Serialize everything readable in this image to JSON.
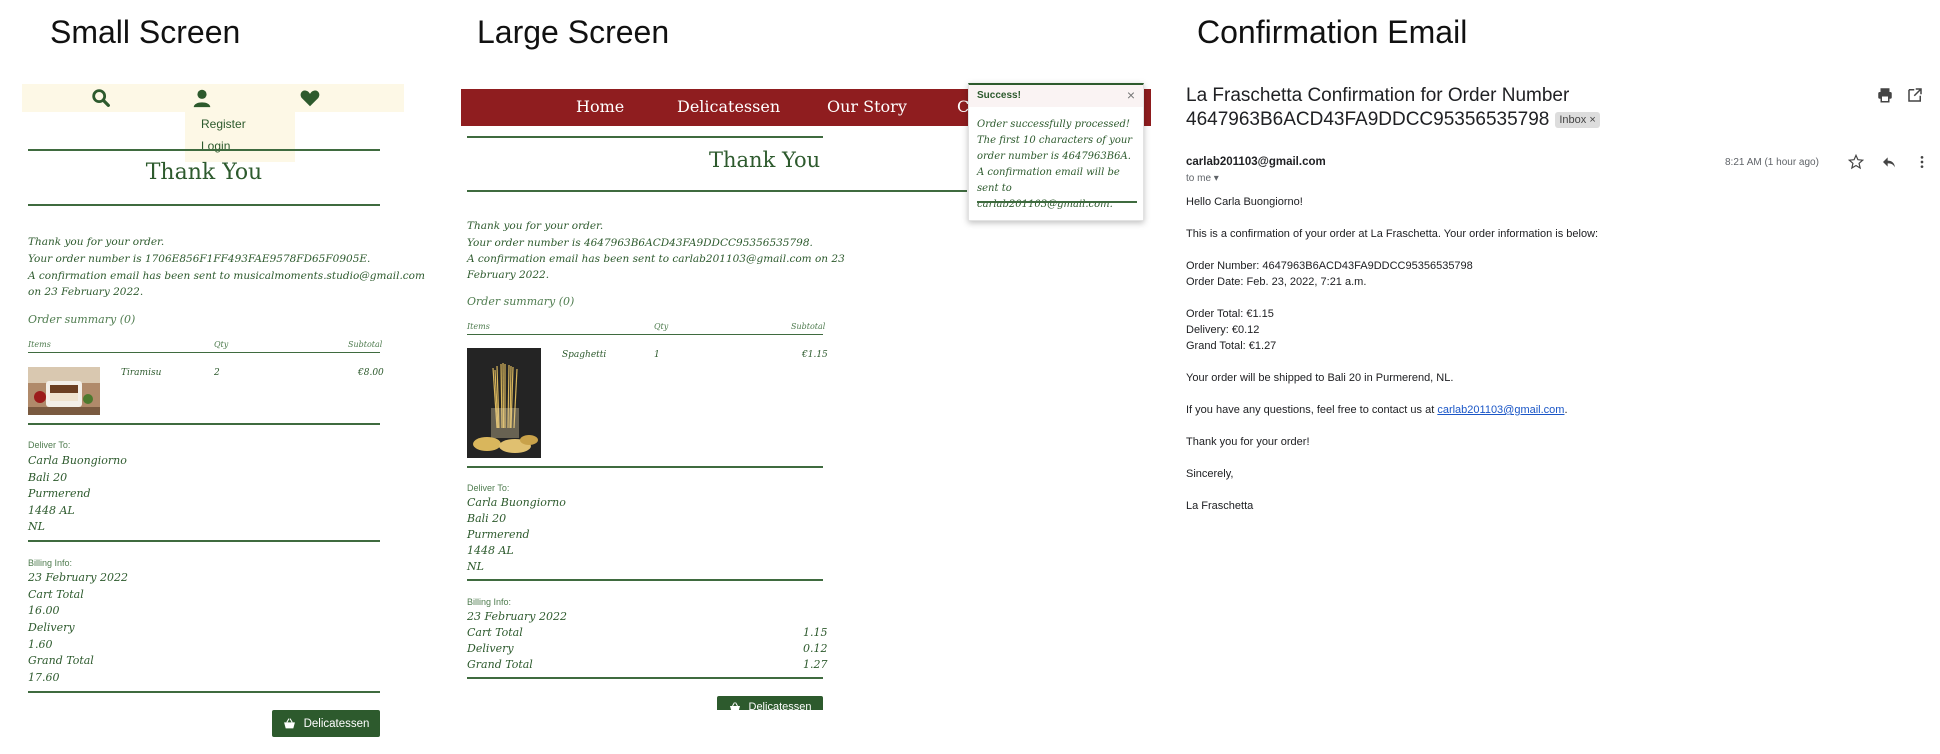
{
  "panels": {
    "small_title": "Small Screen",
    "large_title": "Large Screen",
    "email_title": "Confirmation Email"
  },
  "small": {
    "nav_icons": [
      "search-icon",
      "user-icon",
      "heart-icon"
    ],
    "dropdown": {
      "register": "Register",
      "login": "Login"
    },
    "heading": "Thank You",
    "thanks": "Thank you for your order.",
    "order_number": "Your order number is 1706E856F1FF493FAE9578FD65F0905E.",
    "email_sent_1": "A confirmation email has been sent to musicalmoments.studio@gmail.com",
    "email_sent_2": "on 23 February 2022.",
    "summary": "Order summary (0)",
    "col_items": "Items",
    "col_qty": "Qty",
    "col_subtotal": "Subtotal",
    "item_name": "Tiramisu",
    "item_qty": "2",
    "item_subtotal": "€8.00",
    "deliver_label": "Deliver To:",
    "deliver": [
      "Carla Buongiorno",
      "Bali 20",
      "Purmerend",
      "1448 AL",
      "NL"
    ],
    "billing_label": "Billing Info:",
    "billing": [
      "23 February 2022",
      "Cart Total",
      "16.00",
      "Delivery",
      "1.60",
      "Grand Total",
      "17.60"
    ],
    "button": "Delicatessen"
  },
  "large": {
    "nav": [
      "Home",
      "Delicatessen",
      "Our Story",
      "C"
    ],
    "toast_title": "Success!",
    "toast_close": "×",
    "toast_body": "Order successfully processed! The first 10 characters of your order number is 4647963B6A. A confirmation email will be sent to carlab201103@gmail.com.",
    "heading": "Thank You",
    "thanks": "Thank you for your order.",
    "order_number": "Your order number is 4647963B6ACD43FA9DDCC95356535798.",
    "email_sent_1": "A confirmation email has been sent to carlab201103@gmail.com on 23",
    "email_sent_2": "February 2022.",
    "summary": "Order summary (0)",
    "col_items": "Items",
    "col_qty": "Qty",
    "col_subtotal": "Subtotal",
    "item_name": "Spaghetti",
    "item_qty": "1",
    "item_subtotal": "€1.15",
    "deliver_label": "Deliver To:",
    "deliver": [
      "Carla Buongiorno",
      "Bali 20",
      "Purmerend",
      "1448 AL",
      "NL"
    ],
    "billing_label": "Billing Info:",
    "billing_date": "23 February 2022",
    "billing_rows": [
      {
        "label": "Cart Total",
        "value": "1.15"
      },
      {
        "label": "Delivery",
        "value": "0.12"
      },
      {
        "label": "Grand Total",
        "value": "1.27"
      }
    ],
    "button": "Delicatessen"
  },
  "email": {
    "subject_1": "La Fraschetta Confirmation for Order Number",
    "subject_2": "4647963B6ACD43FA9DDCC95356535798",
    "badge": "Inbox ×",
    "sender": "carlab201103@gmail.com",
    "to_me": "to me ▾",
    "time": "8:21 AM (1 hour ago)",
    "greeting": "Hello Carla Buongiorno!",
    "intro": "This is a confirmation of your order at La Fraschetta. Your order information is below:",
    "order_number": "Order Number: 4647963B6ACD43FA9DDCC95356535798",
    "order_date": "Order Date: Feb. 23, 2022, 7:21 a.m.",
    "order_total": "Order Total: €1.15",
    "delivery": "Delivery: €0.12",
    "grand_total": "Grand Total: €1.27",
    "shipping": "Your order will be shipped to Bali 20 in Purmerend, NL.",
    "contact_prefix": "If you have any questions, feel free to contact us at ",
    "contact_email": "carlab201103@gmail.com",
    "contact_suffix": ".",
    "thanks": "Thank you for your order!",
    "sincerely": "Sincerely,",
    "signature": "La Fraschetta"
  },
  "colors": {
    "brand_green": "#2d5a2d",
    "nav_red": "#8f1d1f",
    "cream": "#fdf8e6",
    "link_blue": "#1a56c7"
  }
}
